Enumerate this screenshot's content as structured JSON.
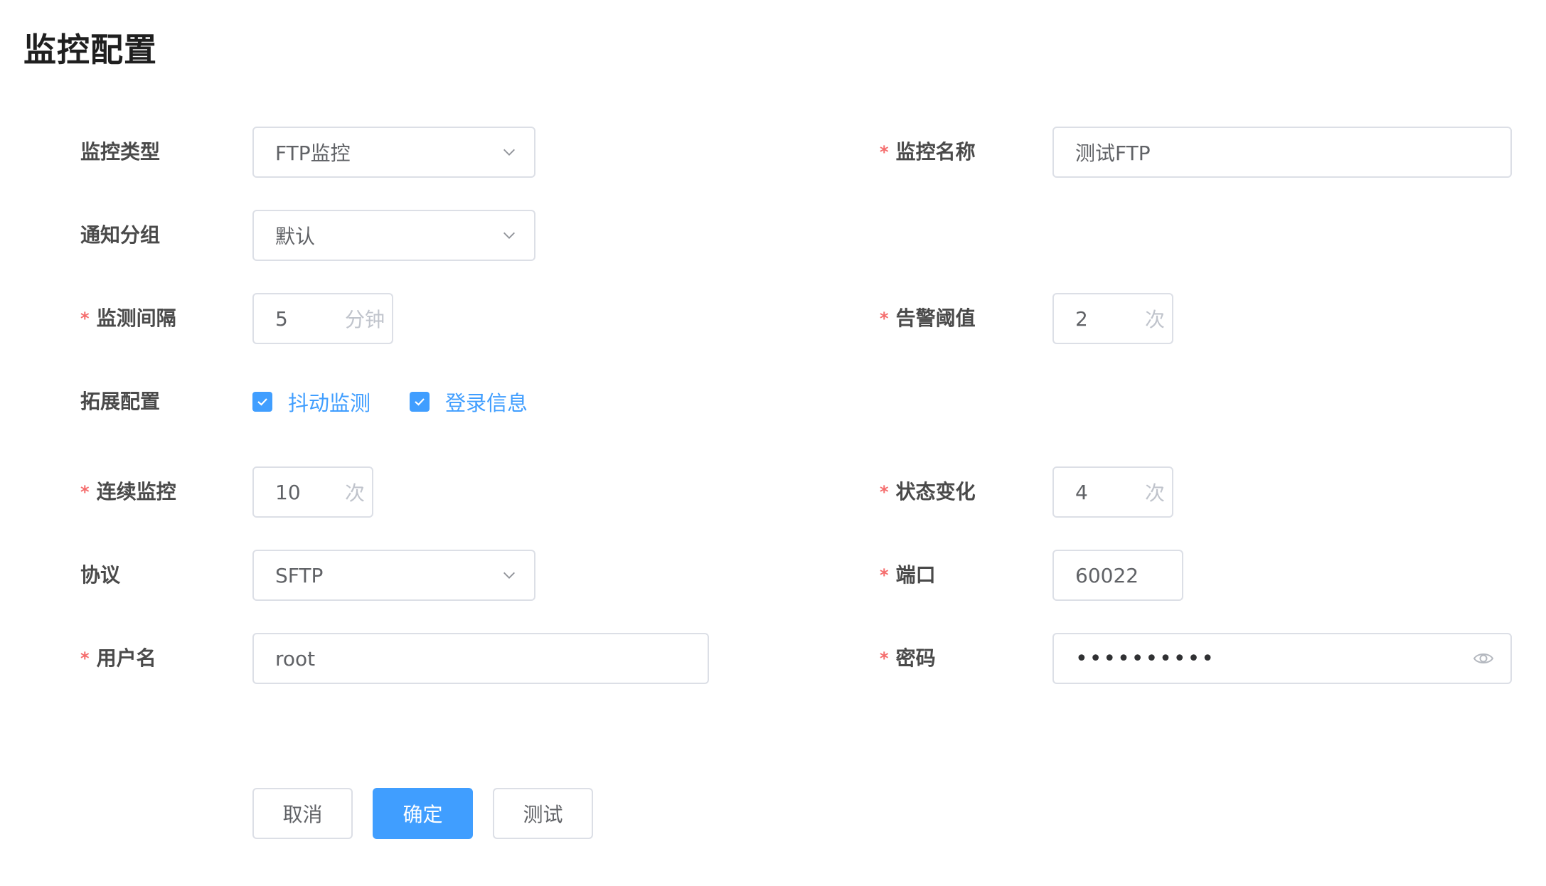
{
  "page": {
    "title": "监控配置"
  },
  "form": {
    "monitor_type": {
      "label": "监控类型",
      "value": "FTP监控"
    },
    "monitor_name": {
      "label": "监控名称",
      "value": "测试FTP"
    },
    "notify_group": {
      "label": "通知分组",
      "value": "默认"
    },
    "interval": {
      "label": "监测间隔",
      "value": "5",
      "unit": "分钟"
    },
    "alert_threshold": {
      "label": "告警阈值",
      "value": "2",
      "unit": "次"
    },
    "extended": {
      "label": "拓展配置",
      "options": [
        {
          "label": "抖动监测",
          "checked": true
        },
        {
          "label": "登录信息",
          "checked": true
        }
      ]
    },
    "consecutive": {
      "label": "连续监控",
      "value": "10",
      "unit": "次"
    },
    "state_change": {
      "label": "状态变化",
      "value": "4",
      "unit": "次"
    },
    "protocol": {
      "label": "协议",
      "value": "SFTP"
    },
    "port": {
      "label": "端口",
      "value": "60022"
    },
    "username": {
      "label": "用户名",
      "value": "root"
    },
    "password": {
      "label": "密码",
      "value": "••••••••••"
    },
    "required_mark": "*"
  },
  "actions": {
    "cancel": "取消",
    "confirm": "确定",
    "test": "测试"
  },
  "colors": {
    "primary": "#409eff",
    "required": "#f56c6c",
    "border": "#dcdfe6",
    "placeholder": "#c0c4cc"
  },
  "icons": {
    "select": "chevron-down-icon",
    "checkbox": "check-icon",
    "password_toggle": "eye-icon"
  }
}
